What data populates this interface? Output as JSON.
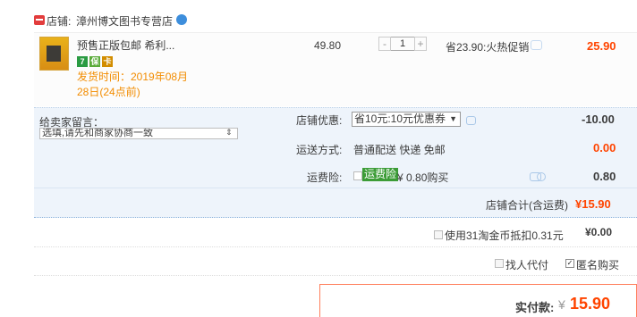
{
  "shop": {
    "label": "店铺:",
    "name": "漳州博文图书专营店"
  },
  "item": {
    "title": "预售正版包邮 希利...",
    "badges": [
      "7",
      "保",
      "卡"
    ],
    "ship_time": "发货时间：2019年08月28日(24点前)",
    "unit_price": "49.80",
    "qty_minus": "-",
    "qty": "1",
    "qty_plus": "+",
    "savings": "省23.90:火热促销",
    "price": "25.90"
  },
  "options": {
    "message_label": "给卖家留言：",
    "message_placeholder": "选填,请先和商家协商一致",
    "coupon_label": "店铺优惠:",
    "coupon_selected": "省10元:10元优惠券",
    "coupon_value": "-10.00",
    "shipping_label": "运送方式:",
    "shipping_value_text": "普通配送 快递 免邮",
    "shipping_value": "0.00",
    "insurance_label": "运费险:",
    "insurance_tag": "运费险",
    "insurance_price": "¥ 0.80购买",
    "insurance_value": "0.80"
  },
  "subtotal": {
    "label": "店铺合计(含运费)",
    "value": "¥15.90"
  },
  "coins": {
    "label": "使用31淘金币抵扣0.31元",
    "value": "¥0.00"
  },
  "extras": {
    "proxy_label": "找人代付",
    "anon_label": "匿名购买"
  },
  "payment": {
    "label": "实付款:",
    "currency": "¥",
    "value": "15.90"
  },
  "colors": {
    "price_red": "#ff4400",
    "promo_green": "#3c9c37",
    "panel_blue": "#eef4fb",
    "ship_orange": "#f28c00"
  }
}
